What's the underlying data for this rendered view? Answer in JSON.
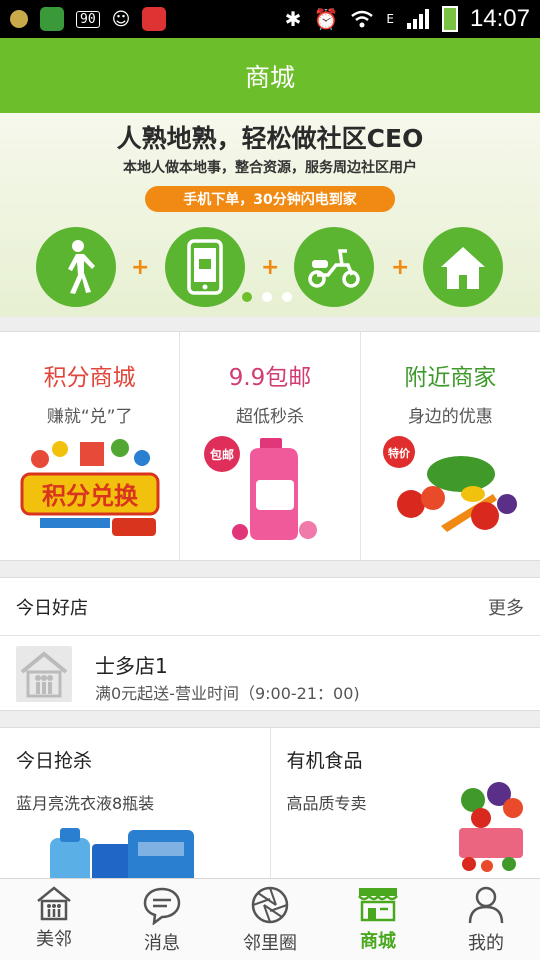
{
  "status_bar": {
    "badge": "90",
    "network_label": "E",
    "time": "14:07"
  },
  "header": {
    "title": "商城"
  },
  "banner": {
    "headline": "人熟地熟，轻松做社区CEO",
    "subline": "本地人做本地事，整合资源，服务周边社区用户",
    "pill": "手机下单，30分钟闪电到家",
    "steps": [
      "walking-person-icon",
      "smartphone-icon",
      "scooter-icon",
      "home-icon"
    ],
    "plus": "+",
    "page_count": 3,
    "active_page": 1
  },
  "promos": [
    {
      "title": "积分商城",
      "subtitle": "赚就“兑”了",
      "color": "#e0463c",
      "image_text": "积分兑换"
    },
    {
      "title": "9.9包邮",
      "subtitle": "超低秒杀",
      "color": "#d23b73",
      "image_text": "包邮"
    },
    {
      "title": "附近商家",
      "subtitle": "身边的优惠",
      "color": "#3e9a2b",
      "image_text": "特价"
    }
  ],
  "shops": {
    "heading": "今日好店",
    "more": "更多",
    "items": [
      {
        "name": "士多店1",
        "info": "满0元起送-营业时间（9:00-21：00)"
      }
    ]
  },
  "deals": [
    {
      "title": "今日抢杀",
      "subtitle": "蓝月亮洗衣液8瓶装"
    },
    {
      "title": "有机食品",
      "subtitle": "高品质专卖"
    }
  ],
  "tabs": [
    {
      "label": "美邻",
      "icon": "house-people-icon",
      "active": false
    },
    {
      "label": "消息",
      "icon": "chat-bubble-icon",
      "active": false
    },
    {
      "label": "邻里圈",
      "icon": "aperture-icon",
      "active": false
    },
    {
      "label": "商城",
      "icon": "storefront-icon",
      "active": true
    },
    {
      "label": "我的",
      "icon": "person-icon",
      "active": false
    }
  ],
  "colors": {
    "brand_green": "#6cbf2a",
    "accent_orange": "#f08a12",
    "active_tab": "#4aa81e"
  }
}
